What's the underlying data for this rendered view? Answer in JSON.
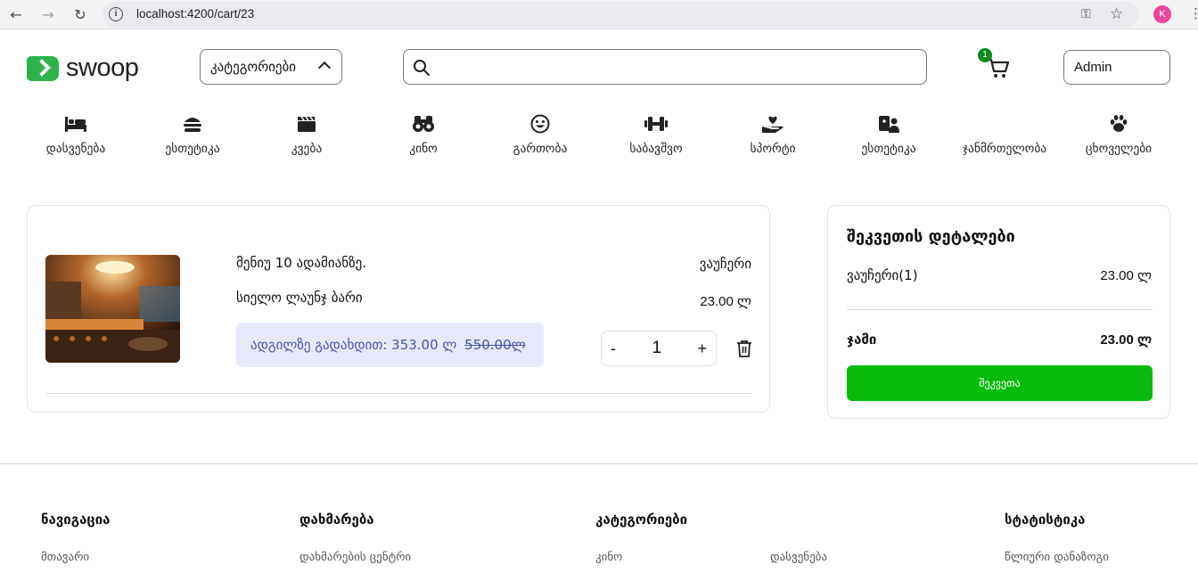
{
  "browser": {
    "url": "localhost:4200/cart/23",
    "profile_initial": "K"
  },
  "header": {
    "logo_text": "swoop",
    "categories_button": "კატეგორიები",
    "search_placeholder": "",
    "cart_count": "1",
    "user_button": "Admin"
  },
  "categories": [
    {
      "label": "დასვენება",
      "icon": "bed-icon"
    },
    {
      "label": "ესთეტიკა",
      "icon": "burger-icon"
    },
    {
      "label": "კვება",
      "icon": "clapperboard-icon"
    },
    {
      "label": "კინო",
      "icon": "binoculars-icon"
    },
    {
      "label": "გართობა",
      "icon": "smile-icon"
    },
    {
      "label": "საბავშვო",
      "icon": "dumbbell-icon"
    },
    {
      "label": "სპორტი",
      "icon": "hand-heart-icon"
    },
    {
      "label": "ესთეტიკა",
      "icon": "medical-person-icon"
    },
    {
      "label": "ჯანმრთელობა",
      "icon": "paw-icon"
    },
    {
      "label": "ცხოველები",
      "icon": "paw-icon"
    }
  ],
  "cart_item": {
    "name": "მენიუ 10 ადამიანზე.",
    "place": "სიელო ლაუნჯ ბარი",
    "type": "ვაუჩერი",
    "price": "23.00 ლ",
    "onsite_label": "ადგილზე გადახდით: 353.00 ლ",
    "old_price": "550.00ლ",
    "quantity": "1",
    "minus": "-",
    "plus": "+"
  },
  "summary": {
    "title": "შეკვეთის დეტალები",
    "row_label": "ვაუჩერი(1)",
    "row_value": "23.00 ლ",
    "total_label": "ჯამი",
    "total_value": "23.00 ლ",
    "order_button": "შეკვეთა"
  },
  "footer": {
    "nav_title": "ნავიგაცია",
    "nav_link": "მთავარი",
    "help_title": "დახმარება",
    "help_link": "დახმარების ცენტრი",
    "cat_title": "კატეგორიები",
    "cat_link_1": "კინო",
    "cat_link_2": "დასვენება",
    "stats_title": "სტატისტიკა",
    "stats_link": "წლიური დანაზოგი"
  }
}
